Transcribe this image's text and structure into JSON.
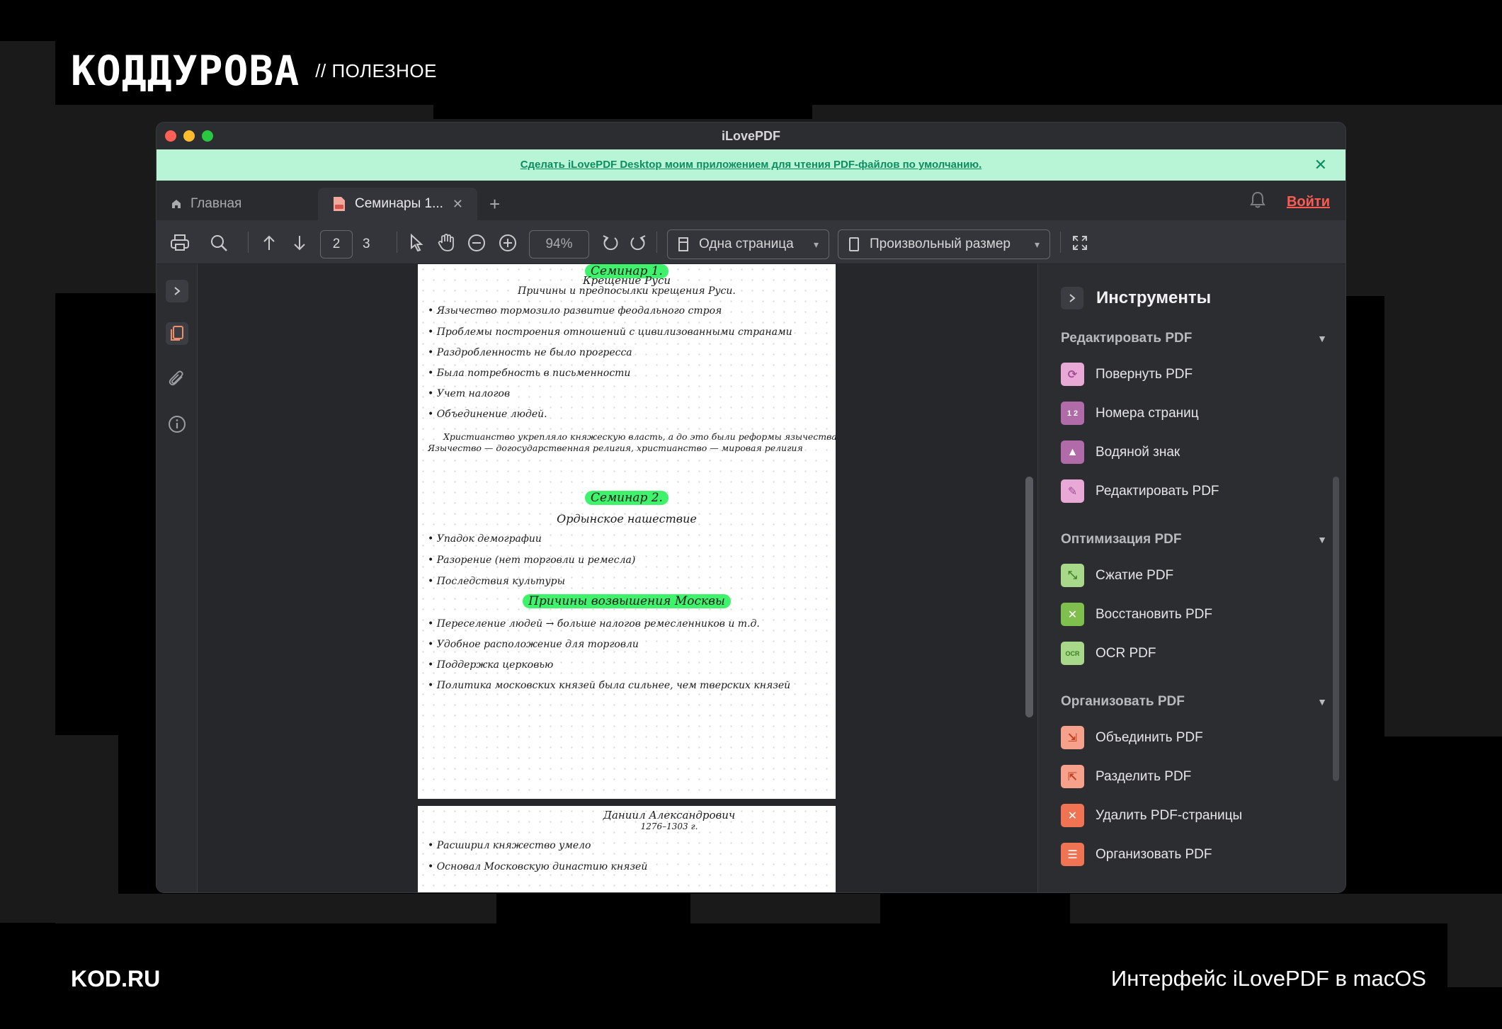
{
  "brand": {
    "logo": "КОДДУРОВА",
    "tag": "// ПОЛЕЗНОЕ"
  },
  "footer": {
    "site": "KOD.RU",
    "caption": "Интерфейс iLovePDF в macOS"
  },
  "window": {
    "title": "iLovePDF"
  },
  "banner": {
    "text": "Сделать iLovePDF Desktop моим приложением для чтения PDF-файлов по умолчанию.",
    "close_icon": "close-icon"
  },
  "tabs": {
    "home_label": "Главная",
    "active_label": "Семинары 1...",
    "add_icon": "plus-icon"
  },
  "header": {
    "login": "Войти",
    "bell_icon": "bell-icon"
  },
  "toolbar": {
    "current_page": "2",
    "total_pages": "3",
    "zoom": "94%",
    "view_mode": "Одна страница",
    "page_size": "Произвольный размер"
  },
  "document": {
    "page1": {
      "title1": "Семинар 1.",
      "subtitle1": "Крещение Руси",
      "subtitle2": "Причины и предпосылки крещения Руси.",
      "bullets1": [
        "• Язычество тормозило развитие феодального строя",
        "• Проблемы построения отношений с цивилизованными странами",
        "• Раздробленность не было прогресса",
        "• Была потребность в письменности",
        "• Учет налогов",
        "• Объединение людей."
      ],
      "para1": "Христианство укрепляло княжескую власть, а до это были реформы язычества",
      "para2": "Язычество — догосударственная религия, христианство — мировая религия",
      "title2": "Семинар 2.",
      "subtitle3": "Ордынское нашествие",
      "bullets2": [
        "• Упадок демографии",
        "• Разорение (нет торговли и ремесла)",
        "• Последствия культуры"
      ],
      "title3": "Причины возвышения Москвы",
      "bullets3": [
        "• Переселение людей → больше налогов ремесленников и т.д.",
        "• Удобное расположение для торговли",
        "• Поддержка церковью",
        "• Политика московских князей была сильнее, чем тверских князей"
      ]
    },
    "page2": {
      "title": "Даниил Александрович",
      "years": "1276–1303 г.",
      "bullets": [
        "• Расширил княжество умело",
        "• Основал Московскую династию князей"
      ]
    }
  },
  "tools": {
    "title": "Инструменты",
    "sections": [
      {
        "label": "Редактировать PDF",
        "items": [
          {
            "label": "Повернуть PDF",
            "icon": "rotate-icon",
            "color": "#e8a9d6"
          },
          {
            "label": "Номера страниц",
            "icon": "page-numbers-icon",
            "color": "#b06ba8"
          },
          {
            "label": "Водяной знак",
            "icon": "stamp-icon",
            "color": "#b06ba8"
          },
          {
            "label": "Редактировать PDF",
            "icon": "pencil-icon",
            "color": "#e8a9d6"
          }
        ]
      },
      {
        "label": "Оптимизация PDF",
        "items": [
          {
            "label": "Сжатие PDF",
            "icon": "compress-icon",
            "color": "#7fbf4d"
          },
          {
            "label": "Восстановить PDF",
            "icon": "repair-icon",
            "color": "#7fbf4d"
          },
          {
            "label": "OCR PDF",
            "icon": "ocr-icon",
            "color": "#7fbf4d"
          }
        ]
      },
      {
        "label": "Организовать PDF",
        "items": [
          {
            "label": "Объединить PDF",
            "icon": "merge-icon",
            "color": "#f07354"
          },
          {
            "label": "Разделить PDF",
            "icon": "split-icon",
            "color": "#f07354"
          },
          {
            "label": "Удалить PDF-страницы",
            "icon": "delete-pages-icon",
            "color": "#f07354"
          },
          {
            "label": "Организовать PDF",
            "icon": "organize-icon",
            "color": "#f07354"
          }
        ]
      }
    ]
  }
}
